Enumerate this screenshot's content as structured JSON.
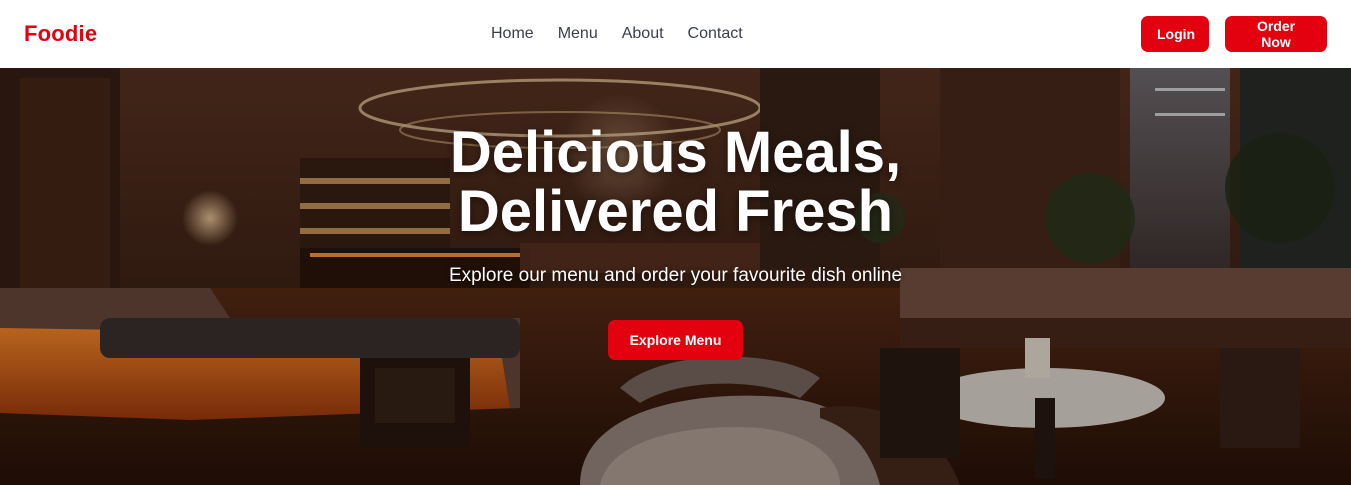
{
  "brand": {
    "name": "Foodie"
  },
  "nav": {
    "links": [
      "Home",
      "Menu",
      "About",
      "Contact"
    ]
  },
  "actions": {
    "login_label": "Login",
    "order_label": "Order Now"
  },
  "hero": {
    "title_line1": "Delicious Meals,",
    "title_line2": "Delivered Fresh",
    "subtitle": "Explore our menu and order your favourite dish online",
    "cta_label": "Explore Menu",
    "background": "restaurant-interior-image"
  },
  "colors": {
    "accent": "#e3000f",
    "nav_text": "#3b3f4a",
    "hero_text": "#ffffff"
  }
}
